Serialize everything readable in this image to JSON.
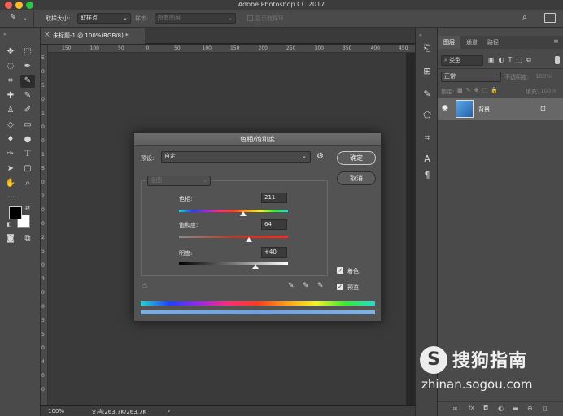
{
  "app": {
    "title": "Adobe Photoshop CC 2017",
    "traffic_lights": [
      "#fe5f57",
      "#febc2e",
      "#28c840"
    ]
  },
  "options_bar": {
    "sample_size_label": "取样大小:",
    "sample_size_value": "取样点",
    "sample_label": "样本:",
    "sample_value": "所有图层",
    "show_ring_label": "显示取样环"
  },
  "document": {
    "tab_title": "未标题-1 @ 100%(RGB/8) *",
    "close_glyph": "×",
    "ruler_top": [
      "150",
      "100",
      "50",
      "0",
      "50",
      "100",
      "150",
      "200",
      "250",
      "300",
      "350",
      "400",
      "450"
    ],
    "ruler_left": [
      "5",
      "0",
      "5",
      "0",
      "1",
      "0",
      "0",
      "1",
      "5",
      "0",
      "2",
      "0",
      "0",
      "2",
      "5",
      "0",
      "3",
      "0",
      "0",
      "3",
      "5",
      "0",
      "4",
      "0",
      "0"
    ],
    "zoom": "100%",
    "doc_info": "文档:263.7K/263.7K",
    "status_arrow": "›"
  },
  "layers_panel": {
    "tabs": [
      "图层",
      "通道",
      "路径"
    ],
    "filter_label": "类型",
    "blend_mode": "正常",
    "opacity_label": "不透明度:",
    "opacity_value": "100%",
    "lock_label": "锁定:",
    "fill_label": "填充:",
    "fill_value": "100%",
    "layer_name": "背景",
    "footer_icons": [
      "link-icon",
      "fx-icon",
      "mask-icon",
      "adjustment-icon",
      "folder-icon",
      "new-layer-icon",
      "trash-icon"
    ]
  },
  "dialog": {
    "title": "色相/饱和度",
    "preset_label": "预设:",
    "preset_value": "自定",
    "ok_label": "确定",
    "cancel_label": "取消",
    "channel_value": "全图",
    "hue_label": "色相:",
    "hue_value": "211",
    "saturation_label": "饱和度:",
    "saturation_value": "64",
    "lightness_label": "明度:",
    "lightness_value": "+40",
    "colorize_label": "着色",
    "preview_label": "预览",
    "colorize_checked": true,
    "preview_checked": true,
    "hue_fraction": 0.586,
    "saturation_fraction": 0.64,
    "lightness_fraction": 0.7
  },
  "watermark": {
    "name": "搜狗指南",
    "url": "zhinan.sogou.com",
    "logo_letter": "S"
  },
  "colors": {
    "foreground": "#000000",
    "background": "#ffffff",
    "layer_thumb": "#3d7fc7"
  }
}
